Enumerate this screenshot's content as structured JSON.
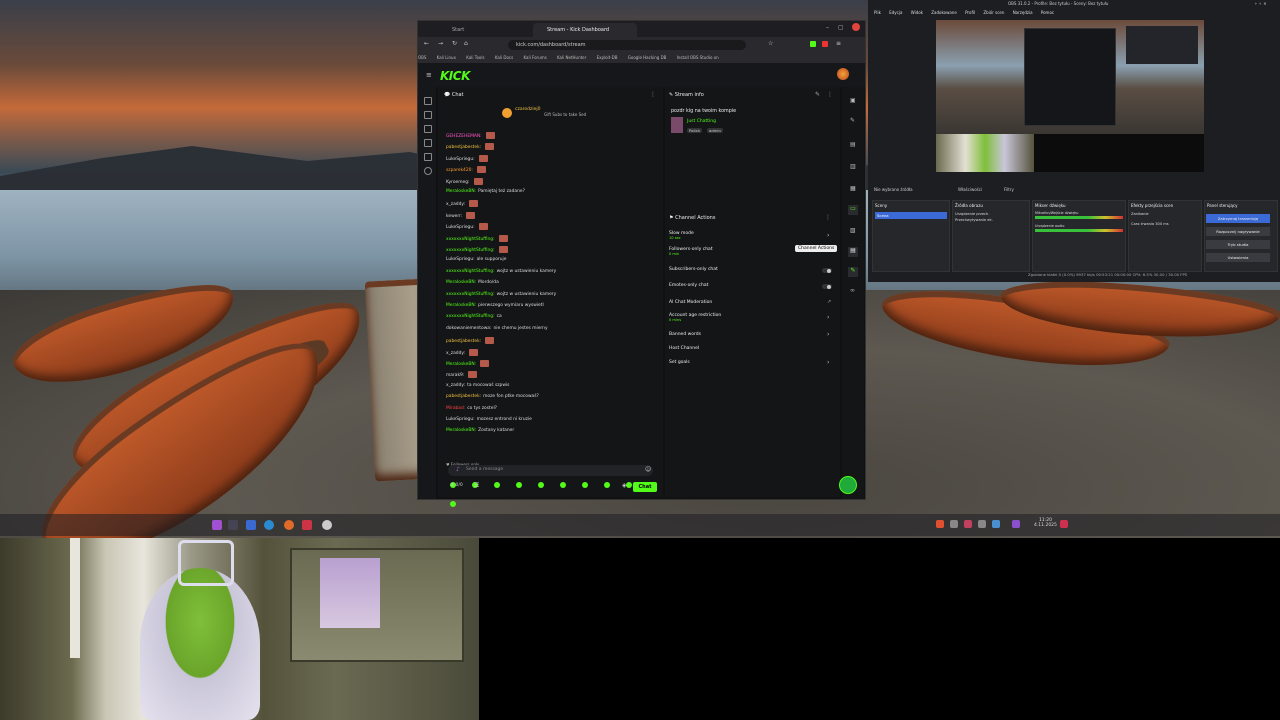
{
  "browser": {
    "tabs": [
      {
        "label": "Start"
      },
      {
        "label": "Stream - Kick Dashboard"
      }
    ],
    "url": "kick.com/dashboard/stream",
    "bookmarks": [
      "OBS",
      "Kali Linux",
      "Kali Tools",
      "Kali Docs",
      "Kali Forums",
      "Kali NetHunter",
      "Exploit-DB",
      "Google Hacking DB",
      "Install OBS Studio on"
    ],
    "logo": "KICK"
  },
  "chat": {
    "title": "Chat",
    "pinned_user": "czarodziej0",
    "pinned_text": "Gift Subs to take Sed",
    "messages": [
      {
        "user": "GEHEZEHEMAN:",
        "text": "",
        "color": "#ff5ac8"
      },
      {
        "user": "pabestjabestek:",
        "text": "",
        "color": "#f0c040"
      },
      {
        "user": "LukeSpriegu:",
        "text": "",
        "color": "#dddddd"
      },
      {
        "user": "szparek420:",
        "text": "",
        "color": "#ff9a2a"
      },
      {
        "user": "Kyroemeg:",
        "text": "",
        "color": "#dddddd"
      },
      {
        "user": "MeraIoskeBN:",
        "text": "Pamiętaj też zadane?",
        "color": "#53fc18"
      },
      {
        "user": "x_zaddy:",
        "text": "",
        "color": "#dddddd"
      },
      {
        "user": "kewerr:",
        "text": "",
        "color": "#dddddd"
      },
      {
        "user": "LukeSpriegu:",
        "text": "",
        "color": "#dddddd"
      },
      {
        "user": "xxxxxxxNightStuffing:",
        "text": "",
        "color": "#53fc18"
      },
      {
        "user": "xxxxxxxNightStuffing:",
        "text": "",
        "color": "#53fc18"
      },
      {
        "user": "LukeSpriegu:",
        "text": "ale supporuje",
        "color": "#dddddd"
      },
      {
        "user": "xxxxxxxNightStuffing:",
        "text": "wojtz w ustawieniu kamery",
        "color": "#53fc18"
      },
      {
        "user": "MeraIoskeBN:",
        "text": "Mordo/da",
        "color": "#53fc18"
      },
      {
        "user": "xxxxxxxNightStuffing:",
        "text": "wojtz w ustawieniu kamery",
        "color": "#53fc18"
      },
      {
        "user": "MeraIoskeBN:",
        "text": "pierwszego wymiaru wyswietl",
        "color": "#53fc18"
      },
      {
        "user": "xxxxxxxNightStuffing:",
        "text": "ca",
        "color": "#53fc18"
      },
      {
        "user": "dokowaniementowa:",
        "text": "nie chemu jestes mierny",
        "color": "#dddddd"
      },
      {
        "user": "pabestjabestek:",
        "text": "",
        "color": "#f0c040"
      },
      {
        "user": "x_zaddy:",
        "text": "",
        "color": "#dddddd"
      },
      {
        "user": "MeraIoskeBN:",
        "text": "",
        "color": "#53fc18"
      },
      {
        "user": "marak9:",
        "text": "",
        "color": "#dddddd"
      },
      {
        "user": "x_zaddy:",
        "text": "ta mocowaś szpwis",
        "color": "#dddddd"
      },
      {
        "user": "pabestjabestek:",
        "text": "moze fon ptke mocowaś?",
        "color": "#f0c040"
      },
      {
        "user": "Mirabad:",
        "text": "co tys zostel?",
        "color": "#ff4444"
      },
      {
        "user": "LukeSpriegu:",
        "text": "mozesz entrond ni kruzie",
        "color": "#dddddd"
      },
      {
        "user": "MeraIoskeBN:",
        "text": "Zostany kataner",
        "color": "#53fc18"
      }
    ],
    "followers_only": "Followers only",
    "input_placeholder": "Send a message",
    "send_label": "Chat",
    "counter": "0/0"
  },
  "stream_info": {
    "title": "Stream info",
    "stream_title": "pozdr kig na twoim kompie",
    "category": "Just Chatting",
    "tags": [
      "Polish",
      "admin"
    ]
  },
  "channel_actions": {
    "title": "Channel Actions",
    "tooltip": "Channel Actions",
    "rows": [
      {
        "label": "Slow mode",
        "sub": "10 sec",
        "control": "chevron"
      },
      {
        "label": "Followers-only chat",
        "sub": "0 min",
        "control": "none"
      },
      {
        "label": "Subscribers-only chat",
        "sub": "",
        "control": "toggle"
      },
      {
        "label": "Emotes-only chat",
        "sub": "",
        "control": "toggle"
      },
      {
        "label": "AI Chat Moderation",
        "sub": "",
        "control": "none"
      },
      {
        "label": "Account age restriction",
        "sub": "0 mins",
        "control": "chevron"
      },
      {
        "label": "Banned words",
        "sub": "",
        "control": "chevron"
      },
      {
        "label": "Host Channel",
        "sub": "",
        "control": "none"
      },
      {
        "label": "Set goals",
        "sub": "",
        "control": "chevron"
      }
    ]
  },
  "obs": {
    "window_title": "OBS 31.0.2 - Profile: Bez tytułu - Sceny: Bez tytułu",
    "menu": [
      "Plik",
      "Edycja",
      "Widok",
      "Zadokowane",
      "Profil",
      "Zbiór scen",
      "Narzędzia",
      "Pomoc"
    ],
    "source_label": "Nie wybrano źródła",
    "toolbar_buttons": [
      "Właściwości",
      "Filtry"
    ],
    "docks": {
      "scenes": {
        "title": "Sceny",
        "items": [
          "Scena"
        ]
      },
      "sources": {
        "title": "Źródła obrazu",
        "items": [
          "Urządzenie przech.",
          "Przechwytywanie ek."
        ]
      },
      "mixer": {
        "title": "Mikser dźwięku",
        "items": [
          "Mikrofon/Wejście dźwięku",
          "Urządzenie audio"
        ]
      },
      "transitions": {
        "title": "Efekty przejścia scen",
        "items": [
          "Zanikanie",
          "Czas trwania 300 ms"
        ]
      },
      "controls": {
        "title": "Panel sterujący",
        "buttons": [
          "Zatrzymaj transmisję",
          "Rozpocznij nagrywanie",
          "Tryb studia",
          "Ustawienia"
        ]
      }
    },
    "status": "Zgubione klatki 0 (0.0%)   9937 kb/s   00:53:21   00:00:00   CPU: 6.5%   30.00 / 30.00 FPS"
  },
  "taskbar": {
    "time": "11:20",
    "date": "4.11.2025"
  }
}
